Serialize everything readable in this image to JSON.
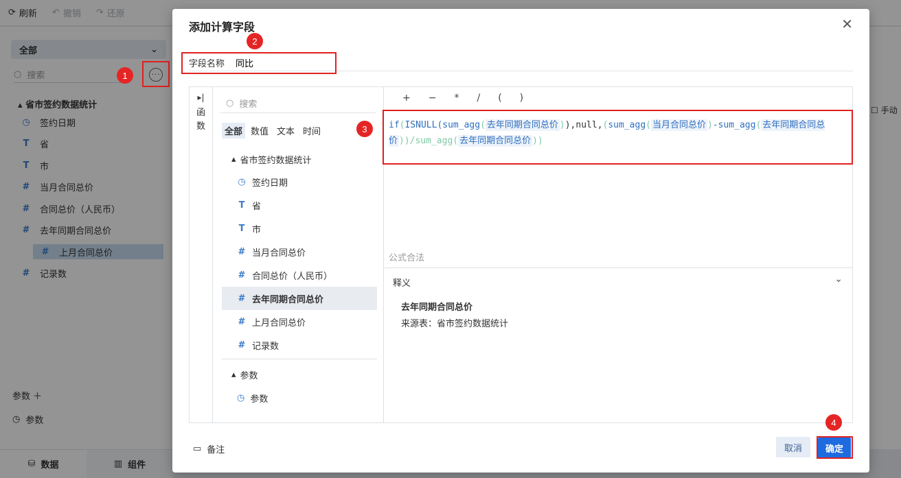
{
  "toolbar": {
    "refresh": "刷新",
    "undo": "撤销",
    "redo": "还原"
  },
  "left_panel": {
    "dataset_select": "全部",
    "search_placeholder": "搜索",
    "table_name": "省市签约数据统计",
    "fields": [
      {
        "icon": "clock-icon",
        "glyph": "◷",
        "label": "签约日期"
      },
      {
        "icon": "text-type-icon",
        "glyph": "T",
        "label": "省"
      },
      {
        "icon": "text-type-icon",
        "glyph": "T",
        "label": "市"
      },
      {
        "icon": "number-type-icon",
        "glyph": "#",
        "label": "当月合同总价"
      },
      {
        "icon": "number-type-icon",
        "glyph": "#",
        "label": "合同总价（人民币）"
      },
      {
        "icon": "number-type-icon",
        "glyph": "#",
        "label": "去年同期合同总价"
      },
      {
        "icon": "number-type-icon",
        "glyph": "#",
        "label": "上月合同总价"
      },
      {
        "icon": "record-count-icon",
        "glyph": "#",
        "label": "记录数"
      }
    ],
    "params_label": "参数",
    "params_item": "参数",
    "bottom_tabs": [
      "数据",
      "组件"
    ]
  },
  "right_panel": {
    "toggle_label": "手动"
  },
  "badges": [
    "1",
    "2",
    "3",
    "4"
  ],
  "dialog": {
    "title": "添加计算字段",
    "close": "✕",
    "name_label": "字段名称",
    "name_value": "同比",
    "side_tab": [
      "函",
      "数"
    ],
    "search_placeholder": "搜索",
    "tabs": [
      "全部",
      "数值",
      "文本",
      "时间"
    ],
    "table_group": "省市签约数据统计",
    "fields": [
      {
        "glyph": "◷",
        "label": "签约日期",
        "active": false
      },
      {
        "glyph": "T",
        "label": "省",
        "active": false
      },
      {
        "glyph": "T",
        "label": "市",
        "active": false
      },
      {
        "glyph": "#",
        "label": "当月合同总价",
        "active": false
      },
      {
        "glyph": "#",
        "label": "合同总价（人民币）",
        "active": false
      },
      {
        "glyph": "#",
        "label": "去年同期合同总价",
        "active": true
      },
      {
        "glyph": "#",
        "label": "上月合同总价",
        "active": false
      },
      {
        "glyph": "#",
        "label": "记录数",
        "active": false
      }
    ],
    "param_group": "参数",
    "param_item": "参数",
    "operators": [
      "+",
      "−",
      "*",
      "/",
      "(",
      ")"
    ],
    "formula": {
      "t1": "if",
      "t2": "(",
      "t3": "ISNULL(sum_agg",
      "t4": "(",
      "f1": "去年同期合同总价",
      "t5": ")",
      "t6": "),null,",
      "t7": "(",
      "t8": "sum_agg",
      "t9": "(",
      "f2": "当月合同总价",
      "t10": ")",
      "t11": "-sum_agg",
      "t12": "(",
      "f3": "去年同期合同总价",
      "t13": ")",
      "t14": ")/sum_agg(",
      "f4": "去年同期合同总价",
      "t15": ")",
      "t16": ")"
    },
    "validity": "公式合法",
    "explain_header": "释义",
    "explain_name": "去年同期合同总价",
    "explain_source": "来源表：省市签约数据统计",
    "note": "备注",
    "cancel": "取消",
    "confirm": "确定"
  }
}
